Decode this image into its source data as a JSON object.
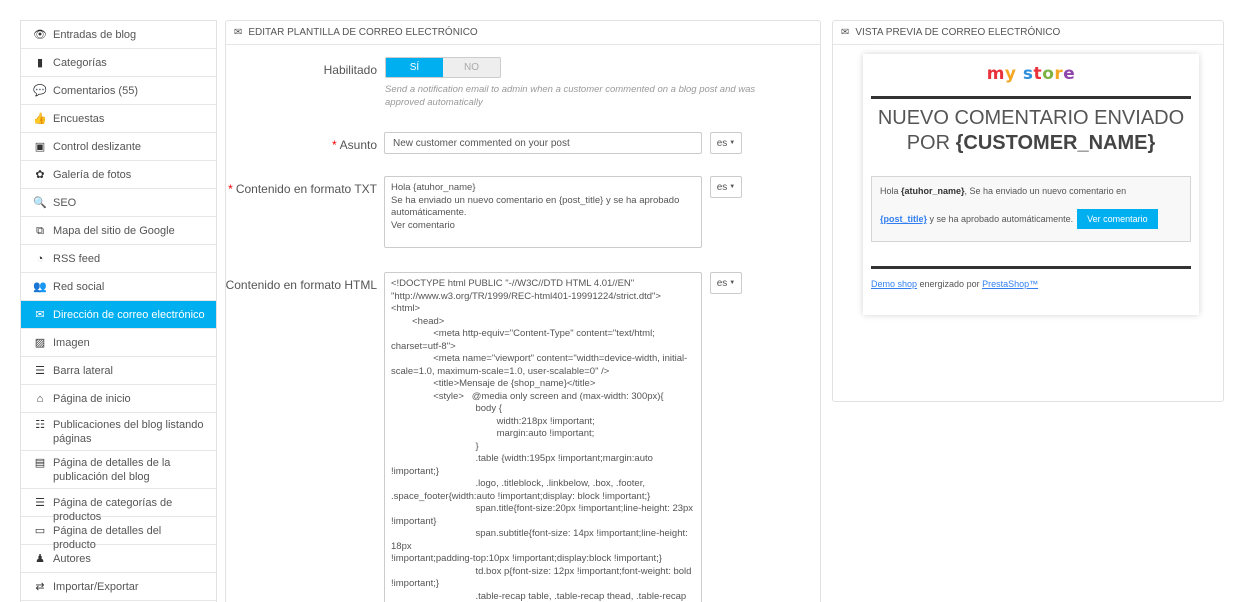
{
  "sidebar": {
    "items": [
      {
        "label": "Entradas de blog",
        "icon": "eye-icon",
        "glyph": "👁"
      },
      {
        "label": "Categorías",
        "icon": "book-icon",
        "glyph": "▮"
      },
      {
        "label": "Comentarios (55)",
        "icon": "comments-icon",
        "glyph": "💬"
      },
      {
        "label": "Encuestas",
        "icon": "thumbs-up-icon",
        "glyph": "👍"
      },
      {
        "label": "Control deslizante",
        "icon": "slider-icon",
        "glyph": "▣"
      },
      {
        "label": "Galería de fotos",
        "icon": "gallery-icon",
        "glyph": "✿"
      },
      {
        "label": "SEO",
        "icon": "seo-icon",
        "glyph": "🔍"
      },
      {
        "label": "Mapa del sitio de Google",
        "icon": "sitemap-icon",
        "glyph": "⧉"
      },
      {
        "label": "RSS feed",
        "icon": "rss-icon",
        "glyph": "◔"
      },
      {
        "label": "Red social",
        "icon": "users-icon",
        "glyph": "👥"
      },
      {
        "label": "Dirección de correo electrónico",
        "icon": "envelope-icon",
        "glyph": "✉"
      },
      {
        "label": "Imagen",
        "icon": "image-icon",
        "glyph": "▨"
      },
      {
        "label": "Barra lateral",
        "icon": "list-icon",
        "glyph": "☰"
      },
      {
        "label": "Página de inicio",
        "icon": "home-icon",
        "glyph": "⌂"
      },
      {
        "label": "Publicaciones del blog listando páginas",
        "icon": "list-alt-icon",
        "glyph": "☷"
      },
      {
        "label": "Página de detalles de la publicación del blog",
        "icon": "list-box-icon",
        "glyph": "▤"
      },
      {
        "label": "Página de categorías de productos",
        "icon": "list-ul-icon",
        "glyph": "☰"
      },
      {
        "label": "Página de detalles del producto",
        "icon": "window-icon",
        "glyph": "▭"
      },
      {
        "label": "Autores",
        "icon": "user-icon",
        "glyph": "♟"
      },
      {
        "label": "Importar/Exportar",
        "icon": "exchange-icon",
        "glyph": "⇄"
      }
    ],
    "active_index": 10,
    "active_color": "#00aff0"
  },
  "edit": {
    "title": "EDITAR PLANTILLA DE CORREO ELECTRÓNICO",
    "enabled_label": "Habilitado",
    "switch_on": "SÍ",
    "switch_off": "NO",
    "enabled_help": "Send a notification email to admin when a customer commented on a blog post and was approved automatically",
    "subject_label": "Asunto",
    "subject_value": "New customer commented on your post",
    "txt_label": "Contenido en formato TXT",
    "txt_value": "Hola {atuhor_name}\nSe ha enviado un nuevo comentario en {post_title} y se ha aprobado automáticamente.\nVer comentario",
    "html_label": "Contenido en formato HTML",
    "html_value": "<!DOCTYPE html PUBLIC \"-//W3C//DTD HTML 4.01//EN\"\n\"http://www.w3.org/TR/1999/REC-html401-19991224/strict.dtd\">\n<html>\n        <head>\n                <meta http-equiv=\"Content-Type\" content=\"text/html;\ncharset=utf-8\">\n                <meta name=\"viewport\" content=\"width=device-width, initial-\nscale=1.0, maximum-scale=1.0, user-scalable=0\" />\n                <title>Mensaje de {shop_name}</title>\n                <style>   @media only screen and (max-width: 300px){\n                                body {\n                                        width:218px !important;\n                                        margin:auto !important;\n                                }\n                                .table {width:195px !important;margin:auto !important;}\n                                .logo, .titleblock, .linkbelow, .box, .footer,\n.space_footer{width:auto !important;display: block !important;}\n                                span.title{font-size:20px !important;line-height: 23px\n!important}\n                                span.subtitle{font-size: 14px !important;line-height: 18px\n!important;padding-top:10px !important;display:block !important;}\n                                td.box p{font-size: 12px !important;font-weight: bold\n!important;}\n                                .table-recap table, .table-recap thead, .table-recap tbody,\n.table-recap th, .table-recap td, .table-recap tr {\n                                        display: block !important;",
    "lang": "es",
    "caret": "▼"
  },
  "preview": {
    "title": "VISTA PREVIA DE CORREO ELECTRÓNICO",
    "logo": [
      {
        "t": "m",
        "c": "#e8313a"
      },
      {
        "t": "y",
        "c": "#f5a623"
      },
      {
        "t": " ",
        "c": "#333"
      },
      {
        "t": "s",
        "c": "#2f8fdc"
      },
      {
        "t": "t",
        "c": "#e8313a"
      },
      {
        "t": "o",
        "c": "#7cb342"
      },
      {
        "t": "r",
        "c": "#f5a623"
      },
      {
        "t": "e",
        "c": "#8e44ad"
      }
    ],
    "heading_line1": "NUEVO COMENTARIO ENVIADO",
    "heading_pre": "POR ",
    "heading_var": "{CUSTOMER_NAME}",
    "body_hola": "Hola ",
    "body_author": "{atuhor_name}",
    "body_text1": ", Se ha enviado un nuevo comentario en",
    "body_post": "{post_title}",
    "body_text2": " y se ha aprobado automáticamente.",
    "button": "Ver comentario",
    "footer_link1": "Demo shop",
    "footer_text": " energizado por ",
    "footer_link2": "PrestaShop™"
  }
}
